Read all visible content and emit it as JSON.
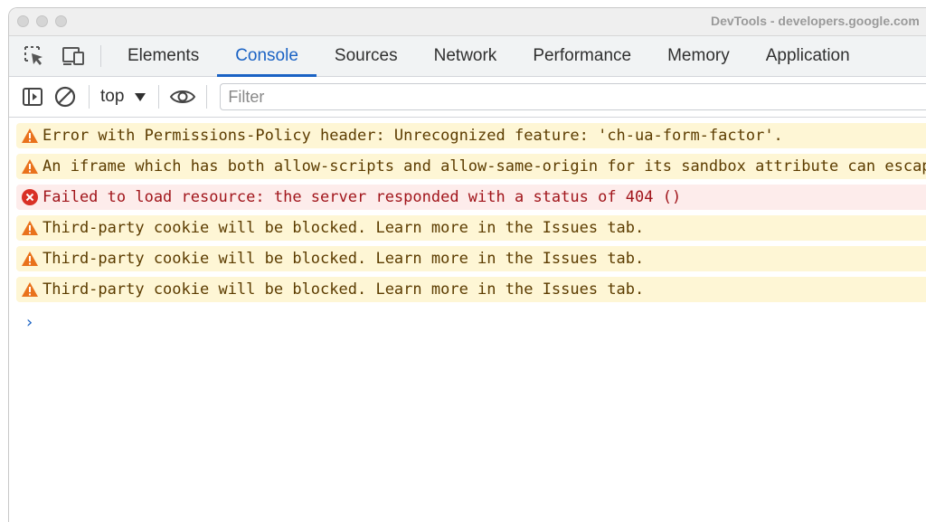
{
  "window": {
    "title": "DevTools - developers.google.com"
  },
  "tabs": [
    {
      "label": "Elements"
    },
    {
      "label": "Console",
      "active": true
    },
    {
      "label": "Sources"
    },
    {
      "label": "Network"
    },
    {
      "label": "Performance"
    },
    {
      "label": "Memory"
    },
    {
      "label": "Application"
    }
  ],
  "toolbar": {
    "context": "top",
    "filter_value": "",
    "filter_placeholder": "Filter"
  },
  "icons": {
    "inspect": "inspect-element-icon",
    "device": "device-toolbar-icon",
    "sidebar": "sidebar-toggle-icon",
    "clear": "clear-console-icon",
    "context_caret": "caret-down-icon",
    "eye": "live-expression-eye-icon",
    "warning": "warning-triangle-icon",
    "error": "error-circle-icon",
    "prompt": "chevron-right-icon"
  },
  "colors": {
    "accent": "#1a62c4",
    "warning_bg": "#fef6d5",
    "warning_icon": "#e9721c",
    "error_bg": "#fdeceb",
    "error_icon": "#d93025"
  },
  "messages": [
    {
      "level": "warning",
      "text": "Error with Permissions-Policy header: Unrecognized feature: 'ch-ua-form-factor'."
    },
    {
      "level": "warning",
      "text": "An iframe which has both allow-scripts and allow-same-origin for its sandbox attribute can escape its sandboxing."
    },
    {
      "level": "error",
      "text": "Failed to load resource: the server responded with a status of 404 ()"
    },
    {
      "level": "warning",
      "text": "Third-party cookie will be blocked. Learn more in the Issues tab."
    },
    {
      "level": "warning",
      "text": "Third-party cookie will be blocked. Learn more in the Issues tab."
    },
    {
      "level": "warning",
      "text": "Third-party cookie will be blocked. Learn more in the Issues tab."
    }
  ],
  "prompt": {
    "symbol": "›"
  }
}
